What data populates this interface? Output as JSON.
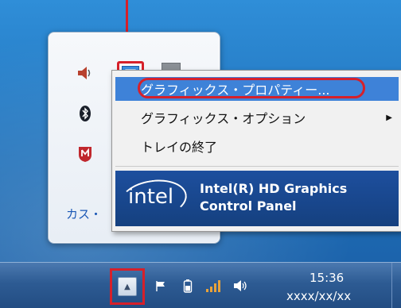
{
  "notification_panel": {
    "customize_link": "カス・"
  },
  "context_menu": {
    "items": [
      {
        "label": "グラフィックス・プロパティー..."
      },
      {
        "label": "グラフィックス・オプション",
        "arrow": "▶"
      },
      {
        "label": "トレイの終了"
      }
    ],
    "intel_banner": {
      "logo_text": "intel",
      "title_line1": "Intel(R) HD Graphics",
      "title_line2": "Control Panel"
    }
  },
  "taskbar": {
    "time": "15:36",
    "date": "xxxx/xx/xx"
  },
  "colors": {
    "highlight": "#3e82d8",
    "annotation_red": "#d6202a",
    "intel_blue": "#1d4f9e"
  },
  "icons": [
    "speaker-icon",
    "intel-graphics-icon",
    "bluetooth-icon",
    "mcafee-icon",
    "flag-icon",
    "battery-icon",
    "network-icon",
    "volume-icon",
    "chevron-up-icon"
  ]
}
